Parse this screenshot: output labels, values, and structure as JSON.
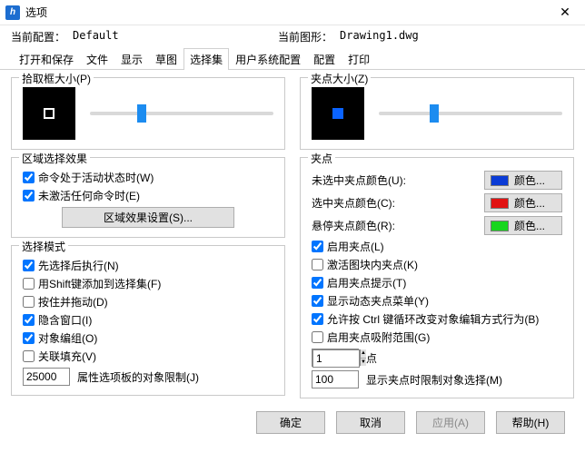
{
  "window": {
    "title": "选项"
  },
  "info": {
    "config_label": "当前配置：",
    "config_value": "Default",
    "drawing_label": "当前图形：",
    "drawing_value": "Drawing1.dwg"
  },
  "tabs": {
    "items": [
      "打开和保存",
      "文件",
      "显示",
      "草图",
      "选择集",
      "用户系统配置",
      "配置",
      "打印"
    ],
    "active_index": 4
  },
  "left": {
    "pickbox": {
      "title": "拾取框大小(P)",
      "slider_percent": 28
    },
    "region": {
      "title": "区域选择效果",
      "active_cmd": {
        "label": "命令处于活动状态时(W)",
        "checked": true
      },
      "no_active": {
        "label": "未激活任何命令时(E)",
        "checked": true
      },
      "settings_btn": "区域效果设置(S)..."
    },
    "mode": {
      "title": "选择模式",
      "presel": {
        "label": "先选择后执行(N)",
        "checked": true
      },
      "shift": {
        "label": "用Shift键添加到选择集(F)",
        "checked": false
      },
      "pressdrag": {
        "label": "按住并拖动(D)",
        "checked": false
      },
      "implied": {
        "label": "隐含窗口(I)",
        "checked": true
      },
      "group": {
        "label": "对象编组(O)",
        "checked": true
      },
      "hatch": {
        "label": "关联填充(V)",
        "checked": false
      },
      "limit_value": "25000",
      "limit_label": "属性选项板的对象限制(J)"
    }
  },
  "right": {
    "gripsize": {
      "title": "夹点大小(Z)",
      "slider_percent": 30
    },
    "grips": {
      "title": "夹点",
      "unsel": {
        "label": "未选中夹点颜色(U):",
        "color": "#0a3bd6",
        "btn": "颜色..."
      },
      "sel": {
        "label": "选中夹点颜色(C):",
        "color": "#e11313",
        "btn": "颜色..."
      },
      "hover": {
        "label": "悬停夹点颜色(R):",
        "color": "#18d61e",
        "btn": "颜色..."
      },
      "enable": {
        "label": "启用夹点(L)",
        "checked": true
      },
      "inblock": {
        "label": "激活图块内夹点(K)",
        "checked": false
      },
      "tips": {
        "label": "启用夹点提示(T)",
        "checked": true
      },
      "dyn_menu": {
        "label": "显示动态夹点菜单(Y)",
        "checked": true
      },
      "ctrl_cycle": {
        "label": "允许按 Ctrl 键循环改变对象编辑方式行为(B)",
        "checked": true
      },
      "snaprange": {
        "label": "启用夹点吸附范围(G)",
        "checked": false
      },
      "snap_value": "1",
      "snap_unit": "点",
      "limit_value": "100",
      "limit_label": "显示夹点时限制对象选择(M)"
    }
  },
  "footer": {
    "ok": "确定",
    "cancel": "取消",
    "apply": "应用(A)",
    "help": "帮助(H)"
  }
}
